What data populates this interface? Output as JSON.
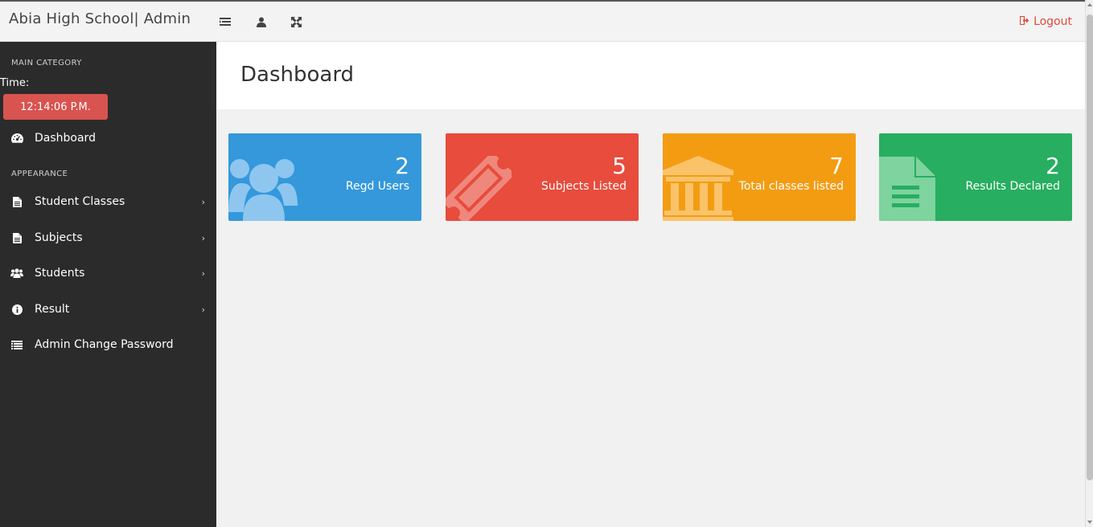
{
  "header": {
    "brand": "Abia High School| Admin",
    "icons": [
      "list-toggle-icon",
      "user-icon",
      "fullscreen-icon"
    ],
    "logout_label": "Logout"
  },
  "sidebar": {
    "main_category": "MAIN CATEGORY",
    "time_label": "Time:",
    "time_value": "12:14:06 P.M.",
    "dashboard_label": "Dashboard",
    "appearance": "APPEARANCE",
    "items": [
      {
        "label": "Student Classes",
        "icon": "file-icon",
        "has_submenu": true
      },
      {
        "label": "Subjects",
        "icon": "file-icon",
        "has_submenu": true
      },
      {
        "label": "Students",
        "icon": "users-icon",
        "has_submenu": true
      },
      {
        "label": "Result",
        "icon": "info-icon",
        "has_submenu": true
      },
      {
        "label": "Admin Change Password",
        "icon": "list-icon",
        "has_submenu": false
      }
    ]
  },
  "main": {
    "title": "Dashboard",
    "cards": [
      {
        "value": "2",
        "caption": "Regd Users",
        "color": "#3498db",
        "icon": "users-icon"
      },
      {
        "value": "5",
        "caption": "Subjects Listed",
        "color": "#e74c3c",
        "icon": "ticket-icon"
      },
      {
        "value": "7",
        "caption": "Total classes listed",
        "color": "#f39c12",
        "icon": "bank-icon"
      },
      {
        "value": "2",
        "caption": "Results Declared",
        "color": "#27ae60",
        "icon": "file-text-icon"
      }
    ]
  },
  "colors": {
    "sidebar_bg": "#2b2b2b",
    "time_badge": "#d9534f",
    "logout": "#e04a3c"
  }
}
